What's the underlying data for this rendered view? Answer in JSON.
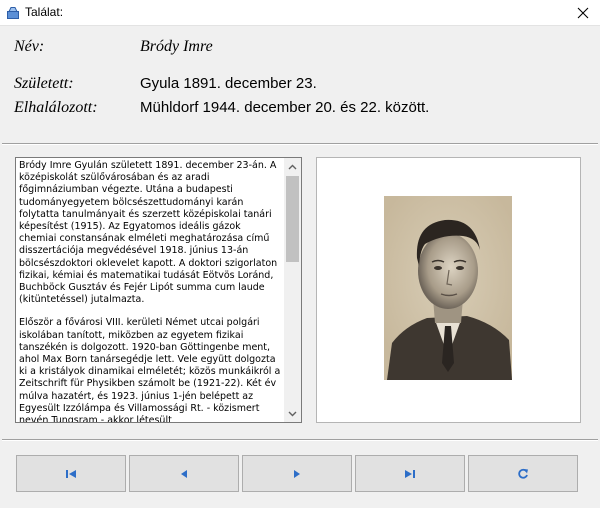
{
  "window": {
    "title": "Találat:",
    "close_icon": "close-icon",
    "app_icon": "window-icon"
  },
  "info": {
    "name_label": "Név:",
    "name_value": "Bródy Imre",
    "born_label": "Született:",
    "born_value": "Gyula 1891. december 23.",
    "died_label": "Elhalálozott:",
    "died_value": "Mühldorf 1944. december 20. és 22. között."
  },
  "bio": {
    "paragraphs": [
      "Bródy Imre Gyulán született 1891. december 23-án. A középiskolát szülővárosában és az aradi főgimnáziumban végezte. Utána a budapesti tudományegyetem bölcsészettudományi karán folytatta tanulmányait és szerzett középiskolai tanári képesítést (1915). Az Egyatomos ideális gázok chemiai constansának elméleti meghatározása című disszertációja megvédésével 1918. június 13-án bölcsészdoktori oklevelet kapott. A doktori szigorlaton fizikai, kémiai és matematikai tudását Eötvös Loránd, Buchböck Gusztáv és Fejér Lipót summa cum laude (kitüntetéssel) jutalmazta.",
      "Először a fővárosi VIII. kerületi Német utcai polgári iskolában tanított, miközben az egyetem fizikai tanszékén is dolgozott. 1920-ban Göttingenbe ment, ahol Max Born tanársegédje lett. Vele együtt dolgozta ki a kristályok dinamikai elméletét; közös munkáikról a Zeitschrift für Physikben számolt be (1921-22). Két év múlva hazatért, és 1923. június 1-jén belépett az Egyesült Izzólámpa és Villamossági Rt. - közismert nevén Tungsram - akkor létesült kutatólaboratóriumába, melyet Pfeifer Ignác, ny. műegyetemi professzor vezetett. Itt végezte azokat a"
    ]
  },
  "photo": {
    "alt_icon": "portrait-photo"
  },
  "nav": {
    "first_icon": "first-record-icon",
    "prev_icon": "previous-record-icon",
    "next_icon": "next-record-icon",
    "last_icon": "last-record-icon",
    "refresh_icon": "refresh-icon"
  },
  "colors": {
    "accent_blue": "#2d6ec8",
    "nav_button_bg": "#e1e1e1"
  }
}
